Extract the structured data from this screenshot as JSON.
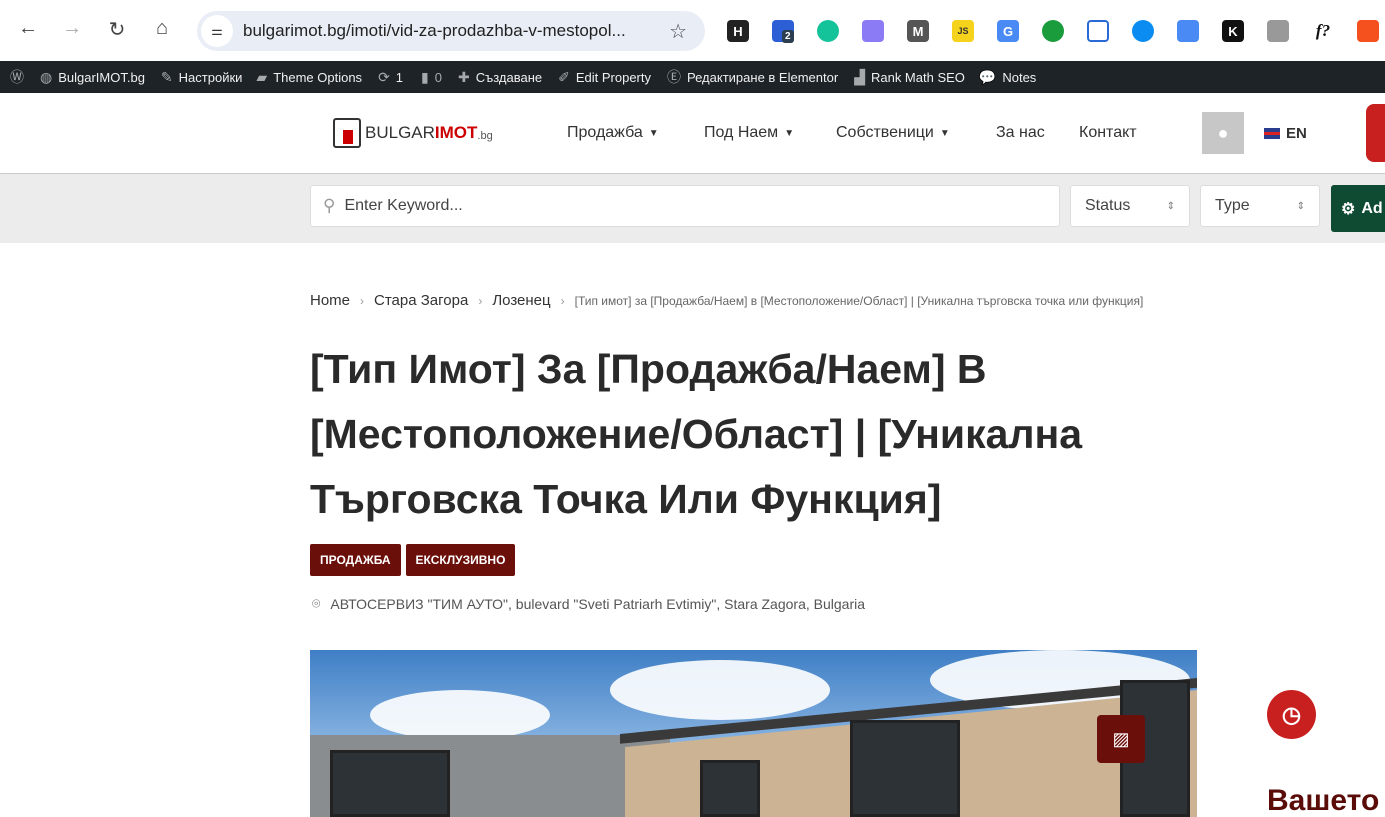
{
  "browser": {
    "url": "bulgarimot.bg/imoti/vid-za-prodazhba-v-mestopol...",
    "extension_badge": "2",
    "ext_labels": [
      "H",
      "",
      "",
      "",
      "M",
      "JS",
      "G",
      "",
      "",
      "",
      "",
      "K",
      "",
      "f?",
      ""
    ]
  },
  "admin_bar": {
    "items": [
      {
        "icon": "wordpress-icon",
        "label": ""
      },
      {
        "icon": "dashboard-icon",
        "label": "BulgarIMOT.bg"
      },
      {
        "icon": "brush-icon",
        "label": "Настройки"
      },
      {
        "icon": "folder-icon",
        "label": "Theme Options"
      },
      {
        "icon": "update-icon",
        "label": "1"
      },
      {
        "icon": "comment-icon",
        "label": "0"
      },
      {
        "icon": "plus-icon",
        "label": "Създаване"
      },
      {
        "icon": "pencil-icon",
        "label": "Edit Property"
      },
      {
        "icon": "elementor-icon",
        "label": "Редактиране в Elementor"
      },
      {
        "icon": "rank-math-icon",
        "label": "Rank Math SEO"
      },
      {
        "icon": "notes-icon",
        "label": "Notes"
      }
    ]
  },
  "header": {
    "logo": {
      "a": "BULGAR",
      "b": "IMOT",
      "c": ".bg"
    },
    "nav": [
      {
        "label": "Продажба",
        "dropdown": true
      },
      {
        "label": "Под Наем",
        "dropdown": true
      },
      {
        "label": "Собственици",
        "dropdown": true
      },
      {
        "label": "За нас"
      },
      {
        "label": "Контакт"
      }
    ],
    "lang": "EN"
  },
  "search": {
    "placeholder": "Enter Keyword...",
    "status": "Status",
    "type": "Type",
    "advanced": "Ad"
  },
  "breadcrumb": [
    "Home",
    "Стара Загора",
    "Лозенец"
  ],
  "breadcrumb_current": "[Тип имот] за [Продажба/Наем] в [Местоположение/Област] | [Уникална търговска точка или функция]",
  "title": "[Тип Имот] За [Продажба/Наем] В [Местоположение/Област] | [Уникална Търговска Точка Или Функция]",
  "tags": [
    "ПРОДАЖБА",
    "ЕКСКЛУЗИВНО"
  ],
  "address": "АВТОСЕРВИЗ \"ТИМ АУТО\", bulevard \"Sveti Patriarh Evtimiy\", Stara Zagora, Bulgaria",
  "sidebar_heading": "Вашето",
  "colors": {
    "accent": "#6b0f0a",
    "red": "#c8201f",
    "green": "#0f4a32",
    "adminbar": "#1d2327"
  }
}
